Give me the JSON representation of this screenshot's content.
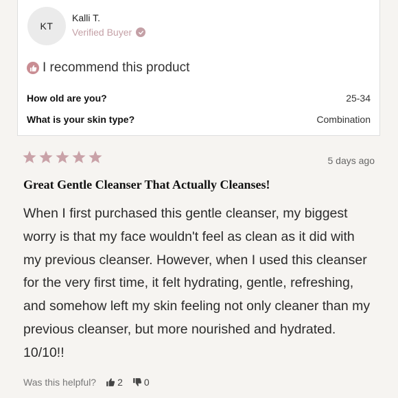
{
  "reviewer": {
    "initials": "KT",
    "name": "Kalli T.",
    "badge": "Verified Buyer"
  },
  "recommend_text": "I recommend this product",
  "questions": [
    {
      "q": "How old are you?",
      "a": "25-34"
    },
    {
      "q": "What is your skin type?",
      "a": "Combination"
    }
  ],
  "review": {
    "rating": 5,
    "date": "5 days ago",
    "title": "Great Gentle Cleanser That Actually Cleanses!",
    "body": "When I first purchased this gentle cleanser, my biggest worry is that my face wouldn't feel as clean as it did with my previous cleanser. However, when I used this cleanser for the very first time, it felt hydrating, gentle, refreshing, and somehow left my skin feeling not only cleaner than my previous cleanser, but more nourished and hydrated. 10/10!!"
  },
  "helpful": {
    "label": "Was this helpful?",
    "up_count": "2",
    "down_count": "0"
  },
  "colors": {
    "accent": "#c4a0a6",
    "star": "#c9a2a8",
    "background": "#f6f4f1"
  },
  "icons": {
    "verified": "check-circle-icon",
    "recommend": "thumbs-up-icon",
    "star": "star-icon",
    "upvote": "thumbs-up-icon",
    "downvote": "thumbs-down-icon"
  }
}
